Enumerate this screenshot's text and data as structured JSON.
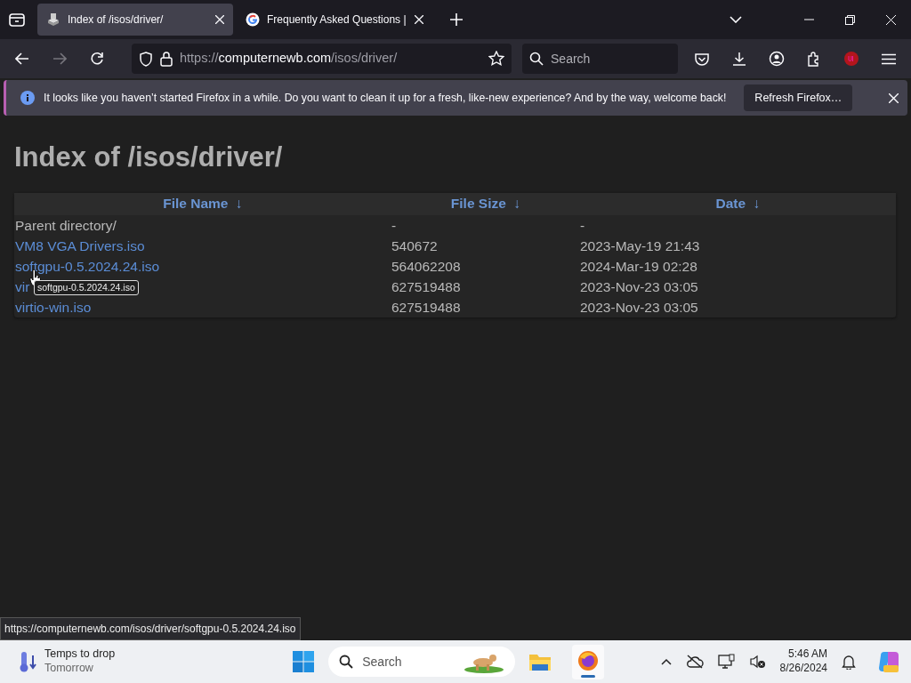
{
  "tabs": [
    {
      "title": "Index of /isos/driver/",
      "selected": true,
      "kind": "folder"
    },
    {
      "title": "Frequently Asked Questions |",
      "selected": false,
      "kind": "google"
    }
  ],
  "toolbar": {
    "url": {
      "scheme": "https://",
      "host": "computernewb.com",
      "path": "/isos/driver/"
    },
    "search": {
      "placeholder": "Search"
    }
  },
  "notification": {
    "text": "It looks like you haven’t started Firefox in a while. Do you want to clean it up for a fresh, like-new experience? And by the way, welcome back!",
    "button": "Refresh Firefox…"
  },
  "page": {
    "heading": "Index of /isos/driver/",
    "table": {
      "columns": [
        {
          "label": "File Name",
          "sort": "↓"
        },
        {
          "label": "File Size",
          "sort": "↓"
        },
        {
          "label": "Date",
          "sort": "↓"
        }
      ],
      "rows": [
        {
          "name": "Parent directory/",
          "kind": "dir",
          "size": "-",
          "date": "-"
        },
        {
          "name": "VM8 VGA Drivers.iso",
          "kind": "file",
          "size": "540672",
          "date": "2023-May-19 21:43"
        },
        {
          "name": "softgpu-0.5.2024.24.iso",
          "kind": "file",
          "size": "564062208",
          "date": "2024-Mar-19 02:28"
        },
        {
          "name": "vir",
          "kind": "file",
          "size": "627519488",
          "date": "2023-Nov-23 03:05"
        },
        {
          "name": "virtio-win.iso",
          "kind": "file",
          "size": "627519488",
          "date": "2023-Nov-23 03:05"
        }
      ]
    },
    "tooltip": "softgpu-0.5.2024.24.iso"
  },
  "status_url": "https://computernewb.com/isos/driver/softgpu-0.5.2024.24.iso",
  "taskbar": {
    "weather": {
      "title": "Temps to drop",
      "subtitle": "Tomorrow"
    },
    "search": {
      "placeholder": "Search"
    },
    "clock": {
      "time": "5:46 AM",
      "date": "8/26/2024"
    }
  }
}
